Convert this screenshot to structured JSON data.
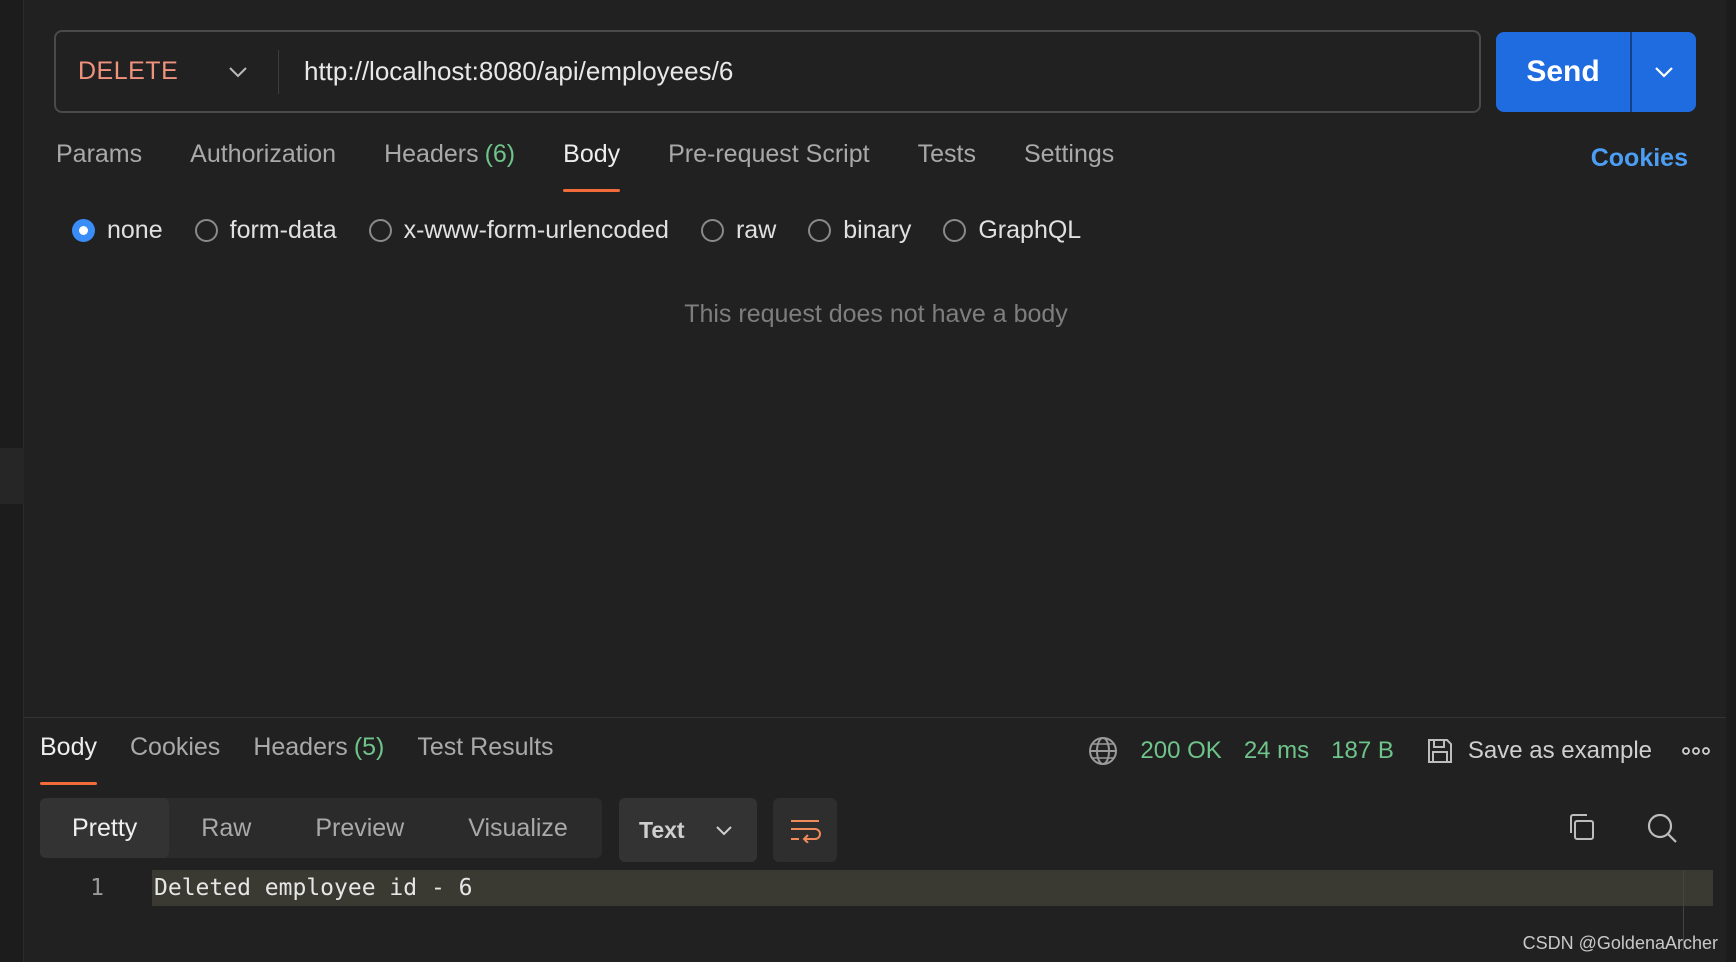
{
  "request": {
    "method": "DELETE",
    "url": "http://localhost:8080/api/employees/6",
    "send_label": "Send"
  },
  "request_tabs": [
    {
      "label": "Params"
    },
    {
      "label": "Authorization"
    },
    {
      "label": "Headers",
      "count": "(6)"
    },
    {
      "label": "Body",
      "active": true
    },
    {
      "label": "Pre-request Script"
    },
    {
      "label": "Tests"
    },
    {
      "label": "Settings"
    }
  ],
  "cookies_link": "Cookies",
  "body_types": [
    {
      "label": "none",
      "checked": true
    },
    {
      "label": "form-data"
    },
    {
      "label": "x-www-form-urlencoded"
    },
    {
      "label": "raw"
    },
    {
      "label": "binary"
    },
    {
      "label": "GraphQL"
    }
  ],
  "empty_body_message": "This request does not have a body",
  "response": {
    "tabs": [
      {
        "label": "Body",
        "active": true
      },
      {
        "label": "Cookies"
      },
      {
        "label": "Headers",
        "count": "(5)"
      },
      {
        "label": "Test Results"
      }
    ],
    "status": "200 OK",
    "time": "24 ms",
    "size": "187 B",
    "save_label": "Save as example",
    "view_modes": [
      "Pretty",
      "Raw",
      "Preview",
      "Visualize"
    ],
    "active_view": "Pretty",
    "format": "Text",
    "lines": [
      {
        "number": "1",
        "text": "Deleted employee id - 6"
      }
    ]
  },
  "watermark": "CSDN @GoldenaArcher",
  "colors": {
    "accent": "#1f6be0",
    "method_delete": "#f0937e",
    "status_ok": "#6ec48a",
    "tab_underline": "#f26b3a",
    "link": "#4c9ef5"
  },
  "icons": {
    "method_dropdown": "chevron-down-icon",
    "send_dropdown": "chevron-down-icon",
    "globe": "globe-icon",
    "save": "save-icon",
    "more": "more-horizontal-icon",
    "wrap": "wrap-lines-icon",
    "copy": "copy-icon",
    "search": "search-icon"
  }
}
